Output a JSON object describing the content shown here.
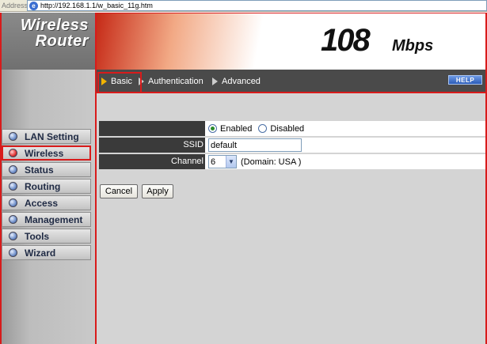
{
  "address_bar": {
    "label": "Address",
    "url": "http://192.168.1.1/w_basic_11g.htm"
  },
  "logo": {
    "line1": "Wireless",
    "line2": "Router"
  },
  "banner": {
    "speed_number": "108",
    "speed_unit": "Mbps"
  },
  "tabs": [
    {
      "label": "Basic",
      "active": true
    },
    {
      "label": "Authentication",
      "active": false
    },
    {
      "label": "Advanced",
      "active": false
    }
  ],
  "help_label": "HELP",
  "sidebar": {
    "items": [
      {
        "label": "LAN Setting",
        "active": false
      },
      {
        "label": "Wireless",
        "active": true
      },
      {
        "label": "Status",
        "active": false
      },
      {
        "label": "Routing",
        "active": false
      },
      {
        "label": "Access",
        "active": false
      },
      {
        "label": "Management",
        "active": false
      },
      {
        "label": "Tools",
        "active": false
      },
      {
        "label": "Wizard",
        "active": false
      }
    ]
  },
  "form": {
    "enable": {
      "label": "",
      "options": [
        "Enabled",
        "Disabled"
      ],
      "selected": "Enabled"
    },
    "ssid": {
      "label": "SSID",
      "value": "default"
    },
    "channel": {
      "label": "Channel",
      "value": "6",
      "domain_note": "(Domain: USA )"
    }
  },
  "buttons": {
    "cancel": "Cancel",
    "apply": "Apply"
  },
  "colors": {
    "highlight_red": "#d81b1b",
    "label_bg": "#3a3a3a",
    "content_bg": "#d4d4d4"
  }
}
